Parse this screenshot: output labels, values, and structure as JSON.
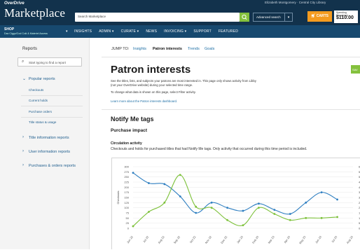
{
  "header": {
    "brand_small": "OverDrive",
    "brand_big": "Marketplace",
    "search_placeholder": "Search Marketplace",
    "advanced_search": "Advanced search",
    "carts": "CARTS",
    "funds_label": "Spending Remaining",
    "funds_amount": "$110.00",
    "user_line": "Elizabeth Montgomery · Central City Library"
  },
  "nav": {
    "shop": "SHOP",
    "shop_sub": "Dav Ciggu/Cod Ccki & Materiel Access",
    "items": [
      "INSIGHTS",
      "ADMIN ▾",
      "CURATE ▾",
      "NEWS",
      "INVOICING ▾",
      "SUPPORT",
      "FEATURED"
    ]
  },
  "sidebar": {
    "title": "Reports",
    "search_placeholder": "Start typing to find a report",
    "popular": "Popular reports",
    "popular_items": [
      "Checkouts",
      "Current holds",
      "Purchase orders",
      "Title status & usage"
    ],
    "groups": [
      "Title information reports",
      "User information reports",
      "Purchases & orders reports"
    ]
  },
  "main": {
    "jump_to": "JUMP TO:",
    "jump_links": [
      "Insights",
      "Patron interests",
      "Trends",
      "Goals"
    ],
    "title": "Patron interests",
    "side_tab": "SAV",
    "para1": "See the titles, lists, and subjects your patrons are most interested in. This page only shows activity from Libby",
    "para2": "(not your OverDrive website) during your selected time range.",
    "para3": "To change what data is shown on this page, select Filter activity.",
    "learn_more": "Learn more about the Patron interests dashboard.",
    "section_title": "Notify Me tags",
    "subsection": "Purchase impact",
    "chart_heading": "Circulation activity",
    "chart_desc": "Checkouts and holds for purchased titles that had Notify Me tags. Only activity that occurred during this time period is included."
  },
  "chart_data": {
    "type": "line",
    "ylabel": "Checkouts",
    "x": [
      "Jun 22",
      "Jul 22",
      "Aug 22",
      "Sep 22",
      "Oct 22",
      "Nov 22",
      "Dec 22",
      "Jan 23",
      "Feb 23",
      "Mar 23",
      "Apr 23",
      "May 23",
      "Jun 23",
      "Jul 23",
      "Aug 23"
    ],
    "yticks_left": [
      0,
      25,
      50,
      75,
      100,
      125,
      150,
      175,
      200,
      225,
      250,
      275,
      300
    ],
    "yticks_right": [
      0,
      5,
      10,
      15,
      20,
      25,
      30,
      35,
      40,
      45,
      50,
      55,
      60
    ],
    "ylim": [
      0,
      300
    ],
    "series": [
      {
        "color": "#2f7fc1",
        "values": [
          270,
          220,
          215,
          155,
          75,
          125,
          100,
          85,
          120,
          90,
          70,
          125,
          175,
          140
        ]
      },
      {
        "color": "#7dc13a",
        "values": [
          10,
          80,
          125,
          260,
          105,
          100,
          40,
          15,
          100,
          70,
          40,
          50,
          50,
          55
        ]
      }
    ]
  },
  "colors": {
    "header": "#12324c",
    "nav": "#17496f",
    "accent_green": "#84c13d",
    "cart_orange": "#f49b1f",
    "link": "#1e6fa5"
  }
}
